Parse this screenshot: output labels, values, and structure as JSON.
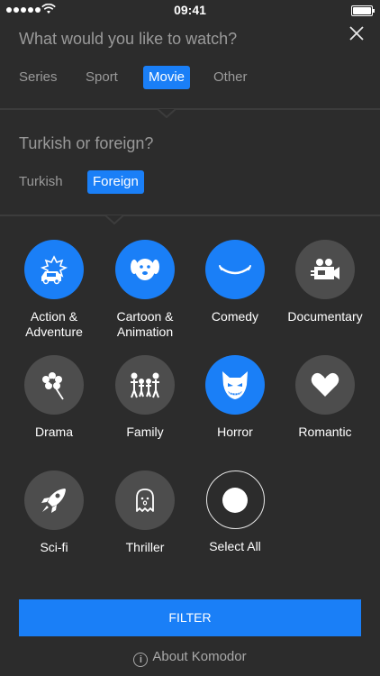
{
  "status_bar": {
    "time": "09:41"
  },
  "type_section": {
    "question": "What would you like to watch?",
    "options": [
      "Series",
      "Sport",
      "Movie",
      "Other"
    ],
    "selected": "Movie"
  },
  "origin_section": {
    "question": "Turkish or foreign?",
    "options": [
      "Turkish",
      "Foreign"
    ],
    "selected": "Foreign"
  },
  "categories": [
    {
      "label": "Action &\nAdventure",
      "icon": "car-crash-icon",
      "selected": true
    },
    {
      "label": "Cartoon &\nAnimation",
      "icon": "dog-face-icon",
      "selected": true
    },
    {
      "label": "Comedy",
      "icon": "smile-icon",
      "selected": true
    },
    {
      "label": "Documentary",
      "icon": "video-camera-icon",
      "selected": false
    },
    {
      "label": "Drama",
      "icon": "flower-icon",
      "selected": false
    },
    {
      "label": "Family",
      "icon": "family-icon",
      "selected": false
    },
    {
      "label": "Horror",
      "icon": "monster-face-icon",
      "selected": true
    },
    {
      "label": "Romantic",
      "icon": "heart-icon",
      "selected": false
    },
    {
      "label": "Sci-fi",
      "icon": "rocket-icon",
      "selected": false
    },
    {
      "label": "Thriller",
      "icon": "ghost-icon",
      "selected": false
    },
    {
      "label": "Select All",
      "icon": "dot-icon",
      "selected": false
    }
  ],
  "filter_button": {
    "label": "FILTER"
  },
  "about_link": {
    "label": "About Komodor"
  },
  "colors": {
    "accent": "#1a7ff7",
    "background": "#2c2c2c",
    "inactive_circle": "#4d4d4d"
  }
}
